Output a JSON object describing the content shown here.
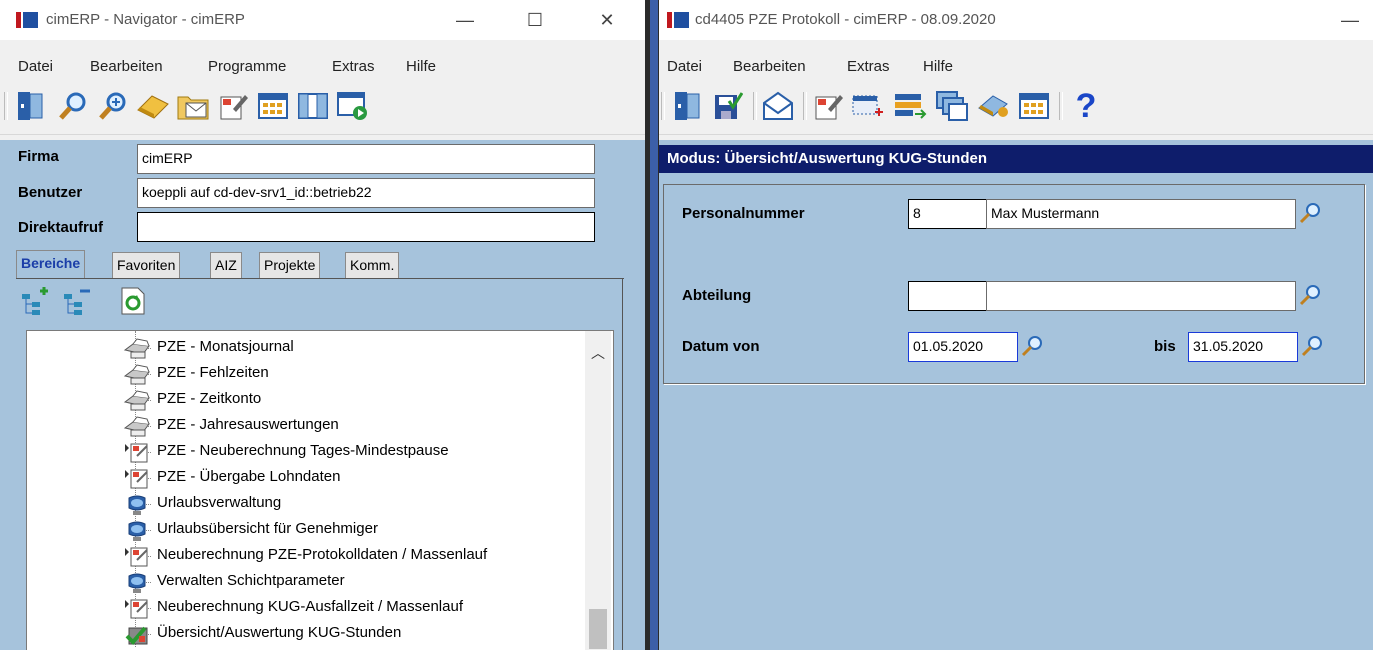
{
  "navigator": {
    "title": "cimERP - Navigator - cimERP",
    "controls": {
      "minimize": "—",
      "maximize": "☐",
      "close": "✕"
    },
    "menu": [
      "Datei",
      "Bearbeiten",
      "Programme",
      "Extras",
      "Hilfe"
    ],
    "fields": {
      "firma_label": "Firma",
      "firma_value": "cimERP",
      "benutzer_label": "Benutzer",
      "benutzer_value": "koeppli auf cd-dev-srv1_id::betrieb22",
      "direktaufruf_label": "Direktaufruf",
      "direktaufruf_value": ""
    },
    "tabs": [
      "Bereiche",
      "Favoriten",
      "AIZ",
      "Projekte",
      "Komm."
    ],
    "tree_items": [
      {
        "label": "PZE - Monatsjournal",
        "icon": "printer-icon"
      },
      {
        "label": "PZE - Fehlzeiten",
        "icon": "printer-icon"
      },
      {
        "label": "PZE - Zeitkonto",
        "icon": "printer-icon"
      },
      {
        "label": "PZE - Jahresauswertungen",
        "icon": "printer-icon"
      },
      {
        "label": "PZE - Neuberechnung Tages-Mindestpause",
        "icon": "batch-icon"
      },
      {
        "label": "PZE - Übergabe Lohndaten",
        "icon": "batch-icon"
      },
      {
        "label": "Urlaubsverwaltung",
        "icon": "monitor-icon"
      },
      {
        "label": "Urlaubsübersicht für Genehmiger",
        "icon": "monitor-icon"
      },
      {
        "label": "Neuberechnung PZE-Protokolldaten / Massenlauf",
        "icon": "batch-icon"
      },
      {
        "label": "Verwalten Schichtparameter",
        "icon": "monitor-icon"
      },
      {
        "label": "Neuberechnung KUG-Ausfallzeit / Massenlauf",
        "icon": "batch-icon"
      },
      {
        "label": "Übersicht/Auswertung KUG-Stunden",
        "icon": "report-icon"
      }
    ]
  },
  "protokoll": {
    "title": "cd4405 PZE Protokoll - cimERP - 08.09.2020",
    "controls": {
      "minimize": "—"
    },
    "menu": [
      "Datei",
      "Bearbeiten",
      "Extras",
      "Hilfe"
    ],
    "mode": "Modus: Übersicht/Auswertung KUG-Stunden",
    "form": {
      "personalnummer_label": "Personalnummer",
      "personalnummer_value": "8",
      "personal_name": "Max Mustermann",
      "abteilung_label": "Abteilung",
      "abteilung_code": "",
      "abteilung_name": "",
      "datum_von_label": "Datum von",
      "datum_von_value": "01.05.2020",
      "bis_label": "bis",
      "datum_bis_value": "31.05.2020"
    }
  },
  "colors": {
    "panel": "#a6c3dc",
    "header": "#0e1d6b",
    "logo_red": "#c0181f",
    "logo_blue": "#1f4fa0"
  }
}
